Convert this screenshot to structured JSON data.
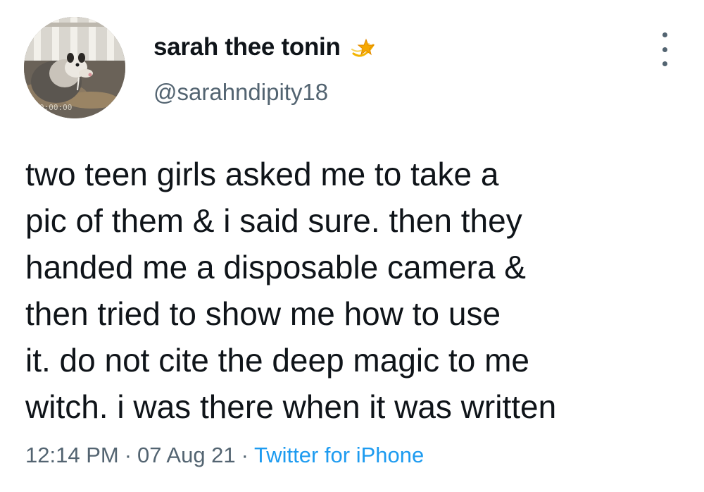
{
  "tweet": {
    "display_name": "sarah thee tonin",
    "display_name_emoji": "shooting-star-emoji",
    "handle": "@sarahndipity18",
    "avatar_caption": "0:00:00",
    "text_lines": [
      "two teen girls asked me to take a",
      "pic of them & i said sure. then they",
      "handed me a disposable camera &",
      "then tried to show me how to use",
      "it. do not cite the deep magic to me",
      "witch. i was there when it was written"
    ],
    "time": "12:14 PM",
    "date": "07 Aug 21",
    "separator": "·",
    "source": "Twitter for iPhone"
  },
  "icons": {
    "more": "more-options-icon",
    "avatar": "opossum-avatar"
  },
  "colors": {
    "text": "#0f1419",
    "secondary": "#536471",
    "link": "#1d9bf0",
    "background": "#ffffff"
  }
}
